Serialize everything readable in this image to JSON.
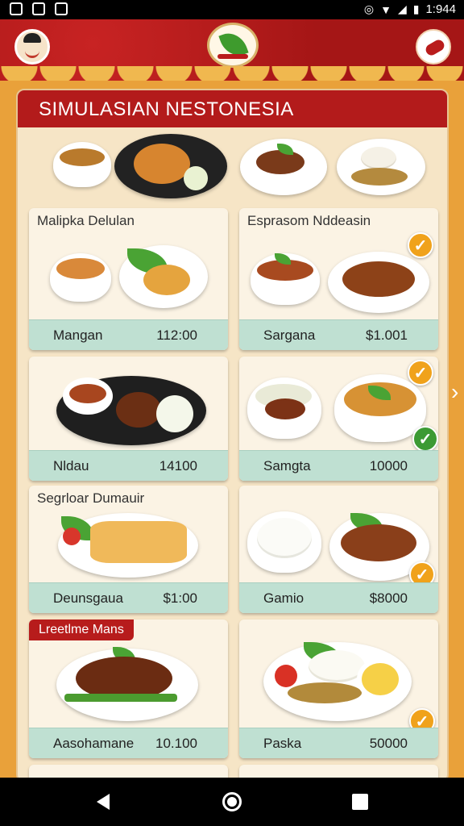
{
  "status_bar": {
    "time": "1:944"
  },
  "panel": {
    "title": "SIMULASIAN NESTONESIA"
  },
  "cards": [
    {
      "title": "Malipka Delulan",
      "name": "Mangan",
      "price": "112:00",
      "badge": ""
    },
    {
      "title": "Esprasom Nddeasin",
      "name": "Sargana",
      "price": "$1.001",
      "badge": "check-orange"
    },
    {
      "title": "",
      "name": "Nldau",
      "price": "14100",
      "badge": ""
    },
    {
      "title": "",
      "name": "Samgta",
      "price": "10000",
      "badge": "check-orange-and-green"
    },
    {
      "title": "Segrloar Dumauir",
      "name": "Deunsgaua",
      "price": "$1:00",
      "badge": ""
    },
    {
      "title": "",
      "name": "Gamio",
      "price": "$8000",
      "badge": "check-orange"
    },
    {
      "title": "",
      "promo": "Lreetlme Mans",
      "name": "Aasohamane",
      "price": "10.100",
      "badge": ""
    },
    {
      "title": "",
      "name": "Paska",
      "price": "50000",
      "badge": "check-orange"
    }
  ],
  "icons": {
    "check": "✓",
    "side_arrow": "›"
  },
  "colors": {
    "header_red": "#a51616",
    "title_bar_red": "#b31b1b",
    "price_strip": "#bfe0d2",
    "badge_orange": "#f0a21b",
    "badge_green": "#3c9a34",
    "page_bg": "#e9a13a"
  }
}
